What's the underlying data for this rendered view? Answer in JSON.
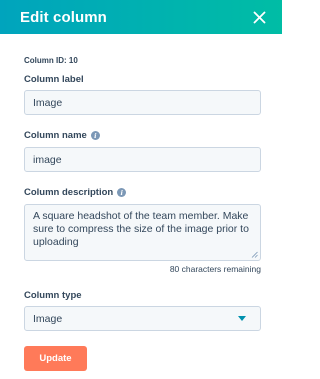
{
  "header": {
    "title": "Edit column"
  },
  "column_id": "Column ID: 10",
  "label_field": {
    "label": "Column label",
    "value": "Image"
  },
  "name_field": {
    "label": "Column name",
    "value": "image"
  },
  "description_field": {
    "label": "Column description",
    "value": "A square headshot of the team member. Make sure to compress the size of the image prior to uploading",
    "remaining": "80 characters remaining"
  },
  "type_field": {
    "label": "Column type",
    "value": "Image"
  },
  "update_button": "Update",
  "colors": {
    "header_start": "#00a4bd",
    "header_end": "#00bda5",
    "button": "#ff7a59",
    "text": "#33475b"
  },
  "icons": {
    "close": "close-icon",
    "info": "info-icon",
    "caret": "chevron-down-icon"
  }
}
